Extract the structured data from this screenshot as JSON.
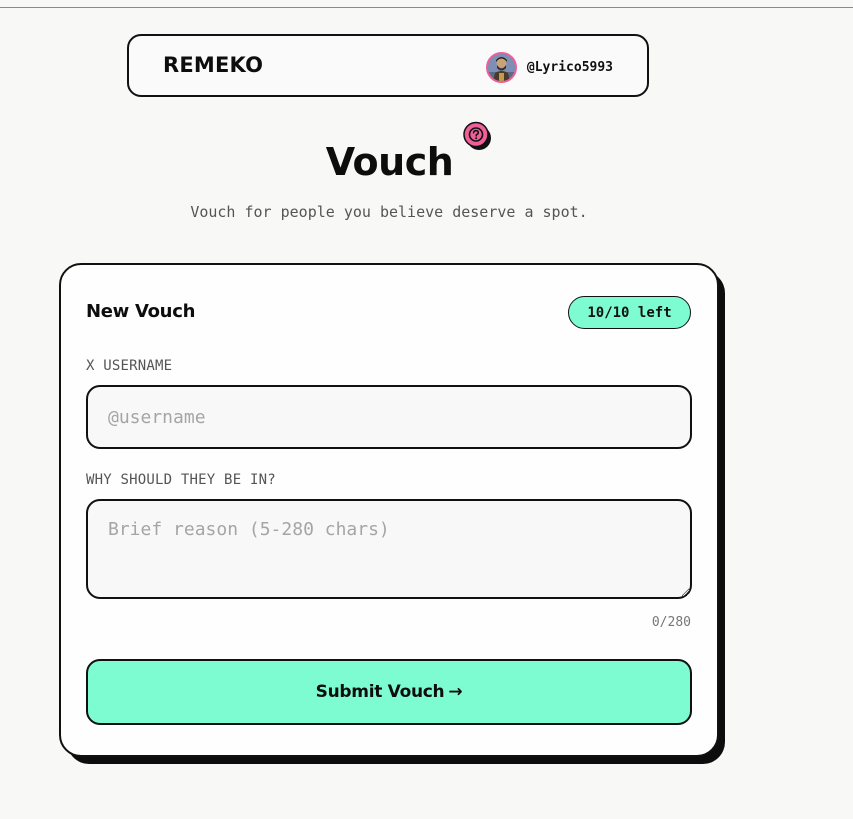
{
  "header": {
    "brand": "REMEKO",
    "user_handle": "@Lyrico5993"
  },
  "page": {
    "title": "Vouch",
    "subtitle": "Vouch for people you believe deserve a spot."
  },
  "form": {
    "heading": "New Vouch",
    "remaining_badge": "10/10 left",
    "username_label": "X USERNAME",
    "username_placeholder": "@username",
    "username_value": "",
    "reason_label": "WHY SHOULD THEY BE IN?",
    "reason_placeholder": "Brief reason (5-280 chars)",
    "reason_value": "",
    "char_count": "0/280",
    "submit_label": "Submit Vouch",
    "submit_arrow": "→"
  },
  "colors": {
    "accent": "#7dfcd2",
    "help_icon": "#ef5f98"
  },
  "icons": {
    "help": "question-circle-icon",
    "avatar": "user-avatar",
    "arrow": "arrow-right-icon"
  }
}
